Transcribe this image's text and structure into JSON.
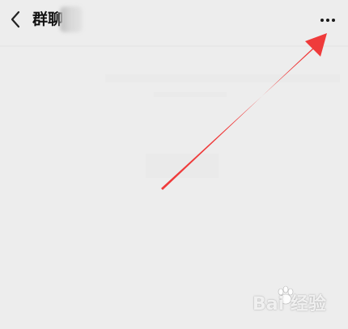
{
  "header": {
    "title": "群聊",
    "back_icon": "chevron-left-icon",
    "more_icon": "more-dots-icon"
  },
  "annotation": {
    "arrow_color": "#ef3b3b"
  },
  "watermark": {
    "text": "Bai 经验"
  }
}
